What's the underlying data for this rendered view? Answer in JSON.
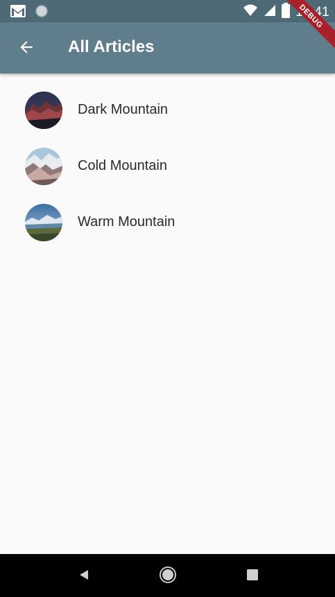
{
  "status_bar": {
    "time": "12:41",
    "icons": [
      "gmail-icon",
      "circle-notification-icon",
      "wifi-icon",
      "cellular-signal-icon",
      "battery-icon"
    ],
    "debug_label": "DEBUG"
  },
  "app_bar": {
    "title": "All Articles",
    "back_icon": "arrow-back-icon",
    "color": "#607d8b"
  },
  "articles": [
    {
      "title": "Dark Mountain",
      "thumbnail": "dark-mountain-avatar"
    },
    {
      "title": "Cold Mountain",
      "thumbnail": "cold-mountain-avatar"
    },
    {
      "title": "Warm Mountain",
      "thumbnail": "warm-mountain-avatar"
    }
  ],
  "nav_bar": {
    "buttons": [
      "back-triangle-icon",
      "home-circle-icon",
      "recents-square-icon"
    ]
  }
}
